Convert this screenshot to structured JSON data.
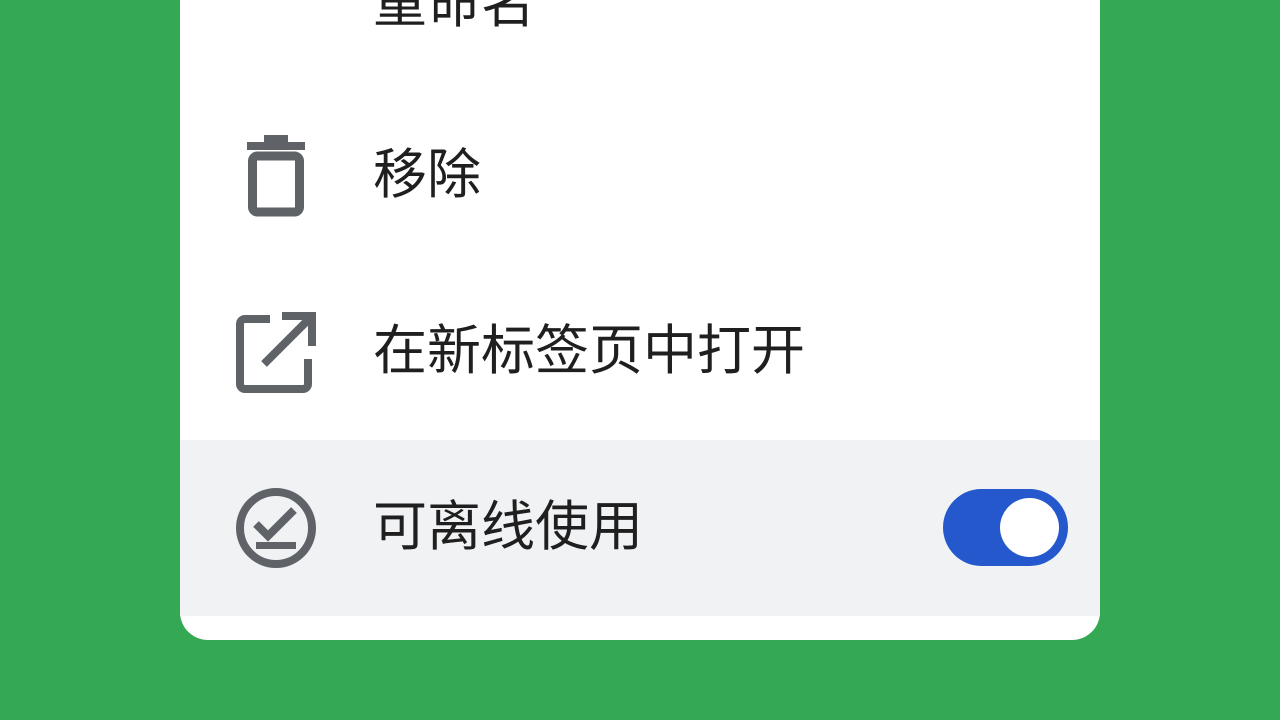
{
  "menu": {
    "items": [
      {
        "label": "重命名",
        "icon": "rename-icon"
      },
      {
        "label": "移除",
        "icon": "trash-icon"
      },
      {
        "label": "在新标签页中打开",
        "icon": "open-in-new-icon"
      },
      {
        "label": "可离线使用",
        "icon": "offline-check-icon",
        "toggle": true
      }
    ]
  },
  "colors": {
    "background": "#34a853",
    "sheet": "#ffffff",
    "highlight_row": "#f0f2f4",
    "icon": "#5f6368",
    "text": "#1f1f1f",
    "toggle_on": "#2458cc"
  }
}
